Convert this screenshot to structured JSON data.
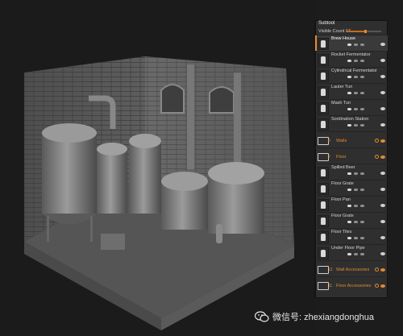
{
  "panel": {
    "title": "Subtool",
    "visible_count_label": "Visible Count 17",
    "slider_fraction": 0.55,
    "accent_color": "#e68a2b"
  },
  "subtools": [
    {
      "type": "mesh",
      "name": "Brew House",
      "selected": true
    },
    {
      "type": "mesh",
      "name": "Rocket Fermentator"
    },
    {
      "type": "mesh",
      "name": "Cylindrical Fermentator"
    },
    {
      "type": "mesh",
      "name": "Lauter Tun"
    },
    {
      "type": "mesh",
      "name": "Mash Tun"
    },
    {
      "type": "mesh",
      "name": "Sordination Station"
    },
    {
      "type": "folder",
      "index": "8",
      "name": "Walls"
    },
    {
      "type": "folder",
      "index": "2",
      "name": "Floor"
    },
    {
      "type": "mesh",
      "name": "Spilled Beer"
    },
    {
      "type": "mesh",
      "name": "Floor Grate"
    },
    {
      "type": "mesh",
      "name": "Floor Pan"
    },
    {
      "type": "mesh",
      "name": "Floor Grate"
    },
    {
      "type": "mesh",
      "name": "Floor Tiles"
    },
    {
      "type": "mesh",
      "name": "Under Floor Pipe"
    },
    {
      "type": "folder",
      "index": "12",
      "name": "Wall Accessories"
    },
    {
      "type": "folder",
      "index": "11",
      "name": "Floor Accessories"
    }
  ],
  "watermark": {
    "text": "微信号: zhexiangdonghua",
    "icon": "wechat-icon"
  },
  "viewport": {
    "scene": "brewery-diorama-render"
  }
}
